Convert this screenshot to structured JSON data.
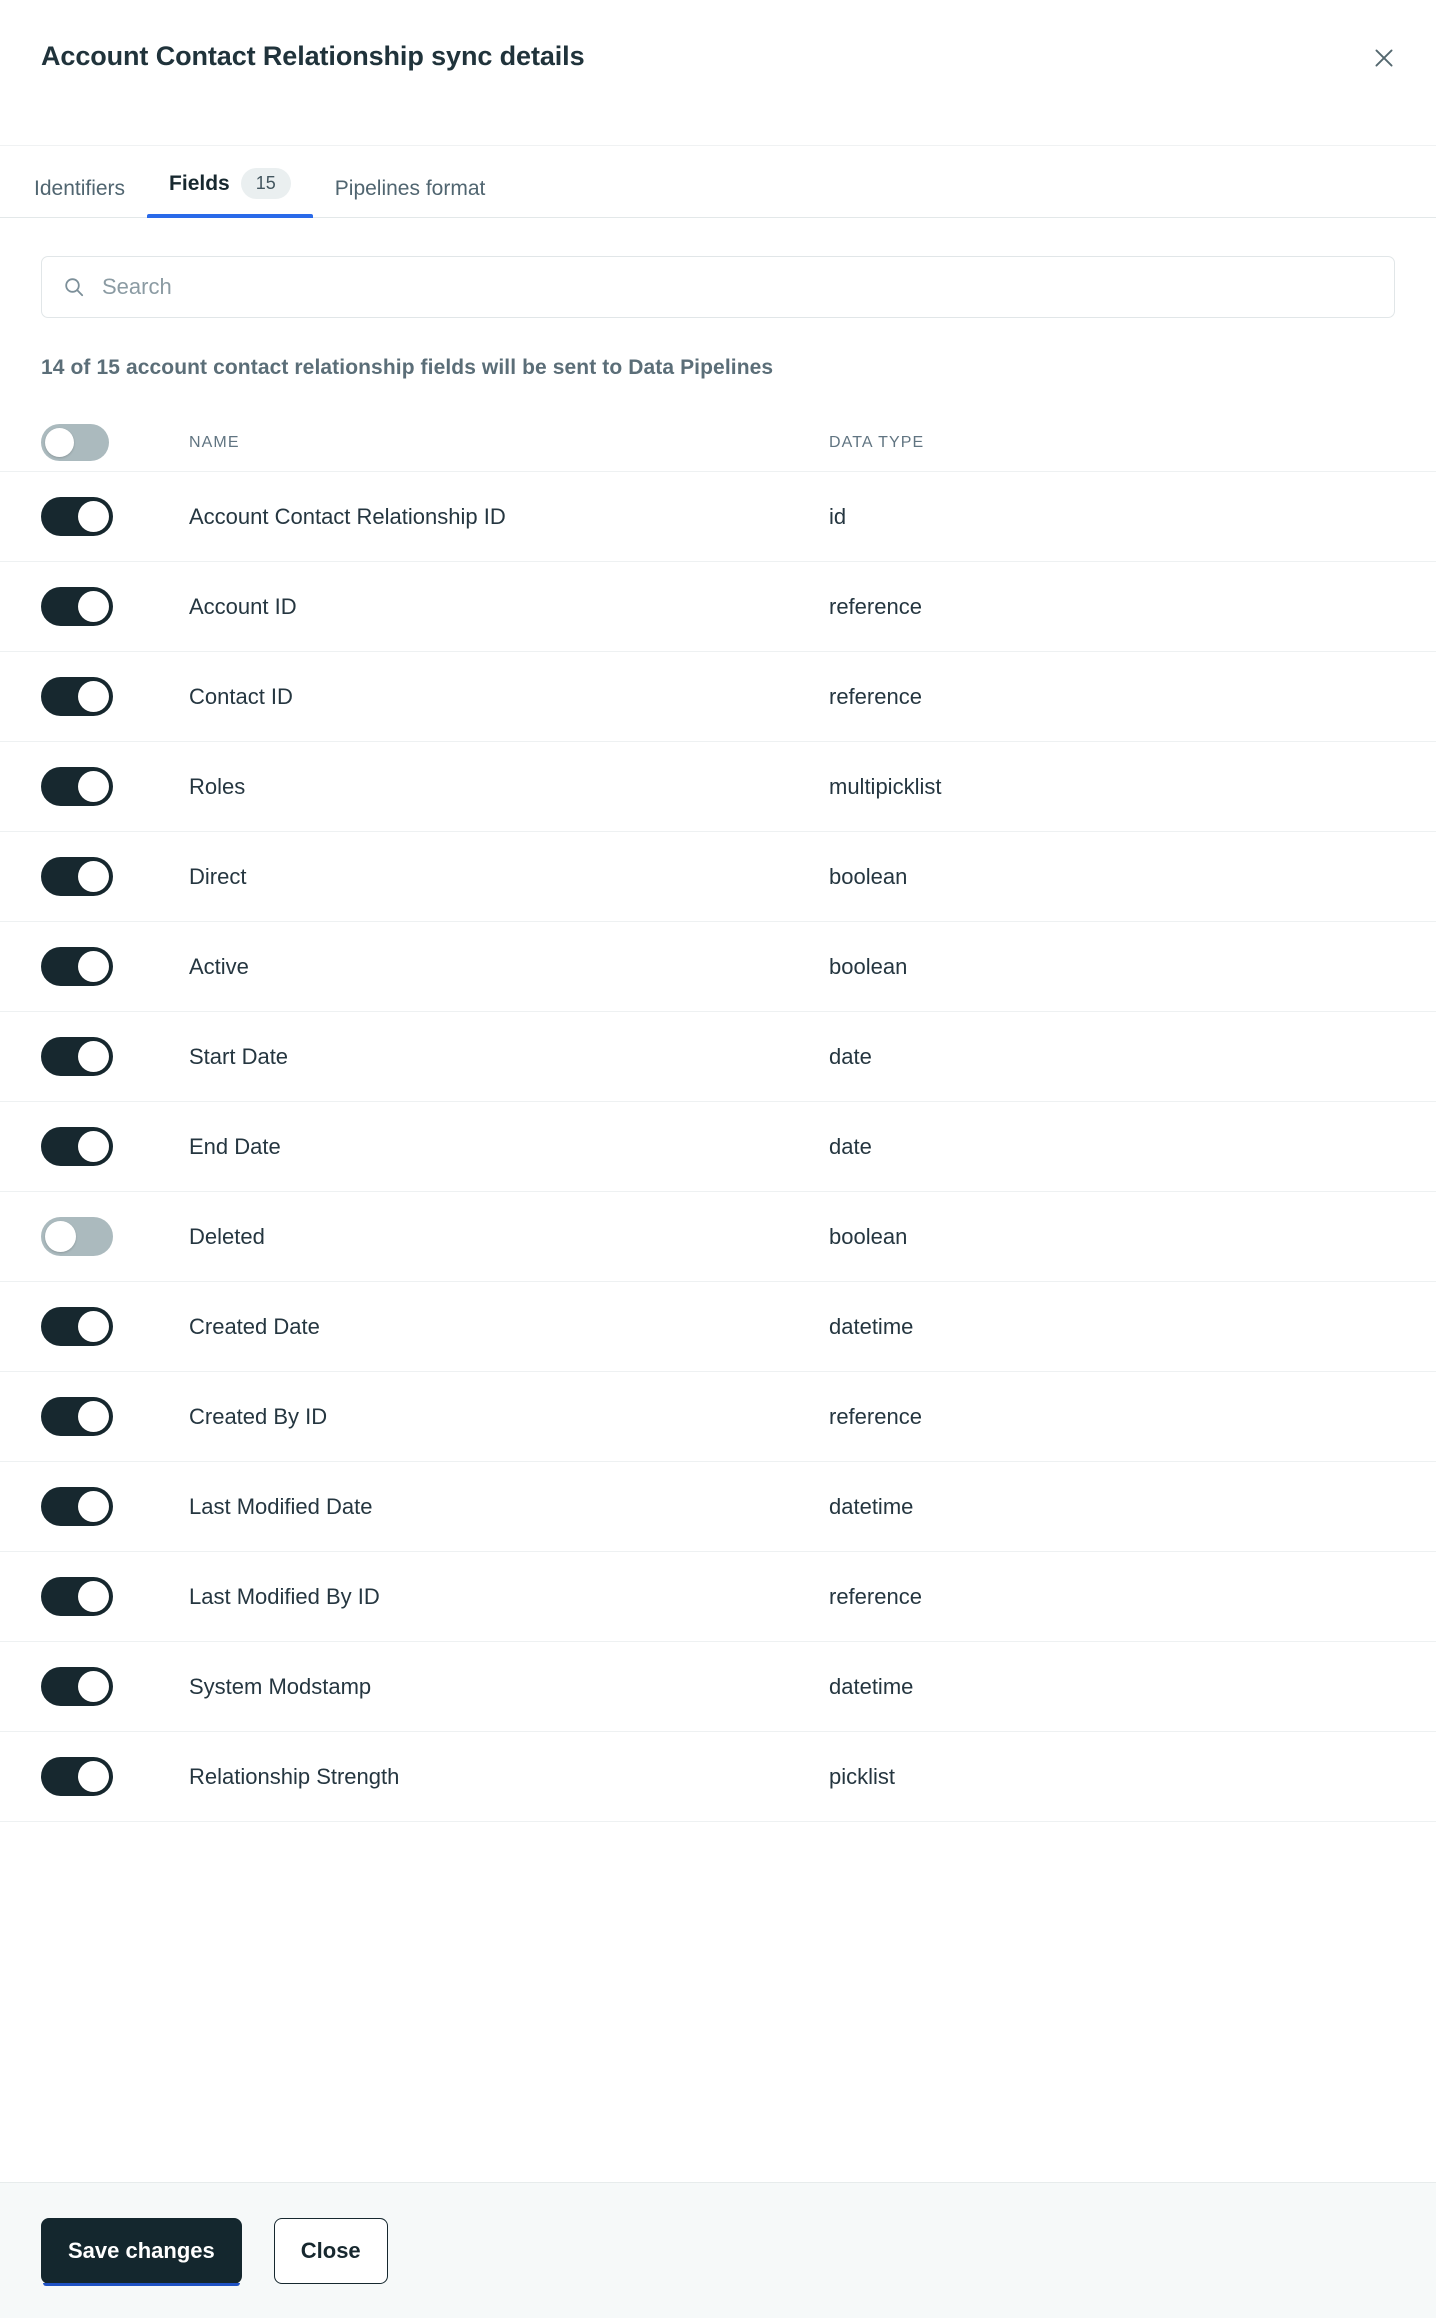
{
  "header": {
    "title": "Account Contact Relationship sync details",
    "close_icon": "close-icon"
  },
  "tabs": [
    {
      "label": "Identifiers",
      "active": false,
      "badge": null
    },
    {
      "label": "Fields",
      "active": true,
      "badge": "15"
    },
    {
      "label": "Pipelines format",
      "active": false,
      "badge": null
    }
  ],
  "search": {
    "placeholder": "Search",
    "value": "",
    "icon": "search-icon"
  },
  "summary": "14 of 15 account contact relationship fields will be sent to Data Pipelines",
  "table": {
    "columns": {
      "toggle": "",
      "name": "NAME",
      "type": "DATA TYPE"
    },
    "select_all": {
      "state": "off"
    },
    "rows": [
      {
        "name": "Account Contact Relationship ID",
        "type": "id",
        "enabled": true
      },
      {
        "name": "Account ID",
        "type": "reference",
        "enabled": true
      },
      {
        "name": "Contact ID",
        "type": "reference",
        "enabled": true
      },
      {
        "name": "Roles",
        "type": "multipicklist",
        "enabled": true
      },
      {
        "name": "Direct",
        "type": "boolean",
        "enabled": true
      },
      {
        "name": "Active",
        "type": "boolean",
        "enabled": true
      },
      {
        "name": "Start Date",
        "type": "date",
        "enabled": true
      },
      {
        "name": "End Date",
        "type": "date",
        "enabled": true
      },
      {
        "name": "Deleted",
        "type": "boolean",
        "enabled": false
      },
      {
        "name": "Created Date",
        "type": "datetime",
        "enabled": true
      },
      {
        "name": "Created By ID",
        "type": "reference",
        "enabled": true
      },
      {
        "name": "Last Modified Date",
        "type": "datetime",
        "enabled": true
      },
      {
        "name": "Last Modified By ID",
        "type": "reference",
        "enabled": true
      },
      {
        "name": "System Modstamp",
        "type": "datetime",
        "enabled": true
      },
      {
        "name": "Relationship Strength",
        "type": "picklist",
        "enabled": true
      }
    ]
  },
  "footer": {
    "save_label": "Save changes",
    "close_label": "Close"
  },
  "colors": {
    "toggle_on": "#17282f",
    "toggle_off": "#abbabe",
    "tab_accent": "#2a6ae9",
    "primary_button": "#14272e",
    "focus_underline": "#1f52c4",
    "footer_background": "#f6f9f9"
  }
}
